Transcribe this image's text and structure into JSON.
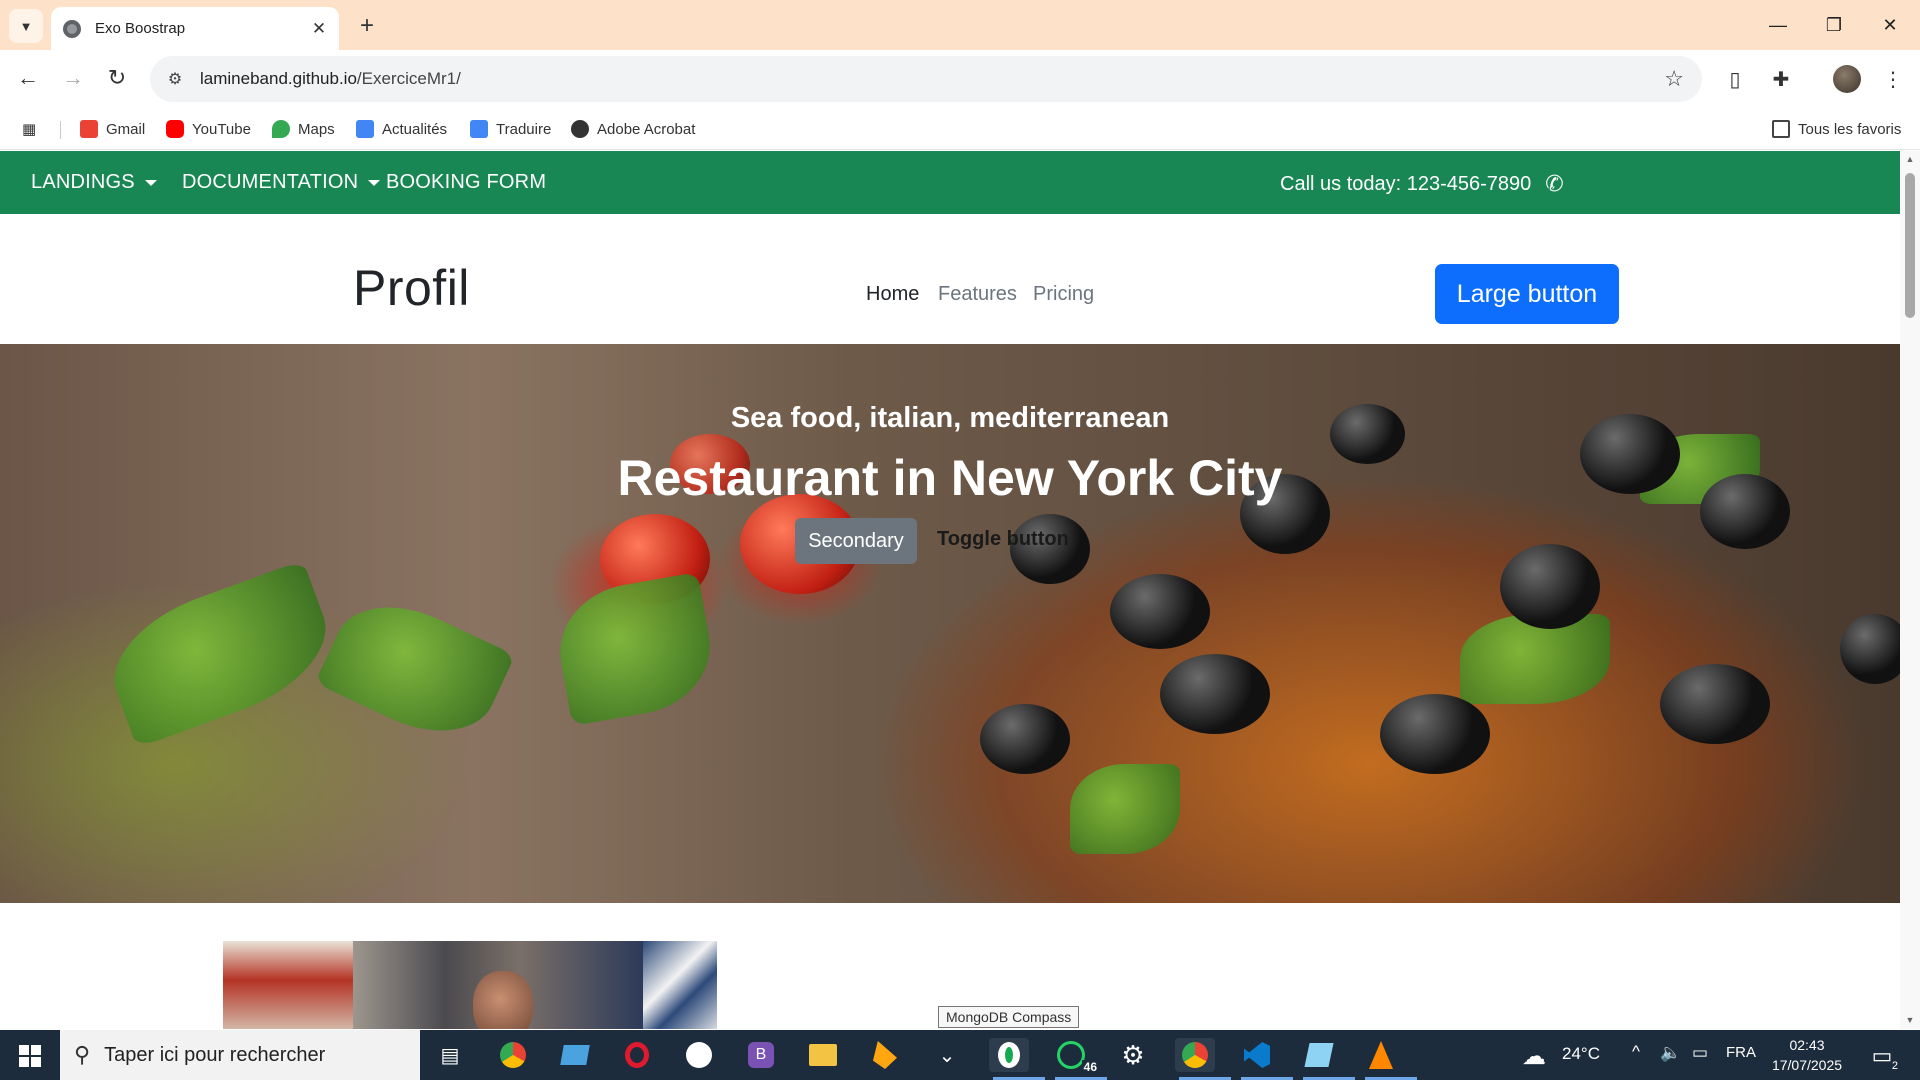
{
  "browser": {
    "tab_title": "Exo Boostrap",
    "url_host": "lamineband.github.io",
    "url_path": "/ExerciceMr1/",
    "bookmarks": [
      {
        "label": "Gmail",
        "color": "#ea4335"
      },
      {
        "label": "YouTube",
        "color": "#ff0000"
      },
      {
        "label": "Maps",
        "color": "#34a853"
      },
      {
        "label": "Actualités",
        "color": "#4285f4"
      },
      {
        "label": "Traduire",
        "color": "#4285f4"
      },
      {
        "label": "Adobe Acrobat",
        "color": "#333333"
      }
    ],
    "all_bookmarks": "Tous les favoris"
  },
  "page": {
    "topbar": {
      "items": [
        "LANDINGS",
        "DOCUMENTATION",
        "BOOKING FORM"
      ],
      "call": "Call us today: 123-456-7890",
      "bg": "#198754"
    },
    "header": {
      "brand": "Profil",
      "nav": [
        "Home",
        "Features",
        "Pricing"
      ],
      "cta": "Large button",
      "cta_color": "#0d6efd"
    },
    "hero": {
      "subtitle": "Sea food, italian, mediterranean",
      "title": "Restaurant in New York City",
      "secondary_button": "Secondary",
      "toggle_button": "Toggle button"
    }
  },
  "tooltip": "MongoDB Compass",
  "taskbar": {
    "search_placeholder": "Taper ici pour rechercher",
    "whatsapp_badge": "46",
    "weather": "24°C",
    "language": "FRA",
    "time": "02:43",
    "date": "17/07/2025",
    "notifications": "2"
  }
}
